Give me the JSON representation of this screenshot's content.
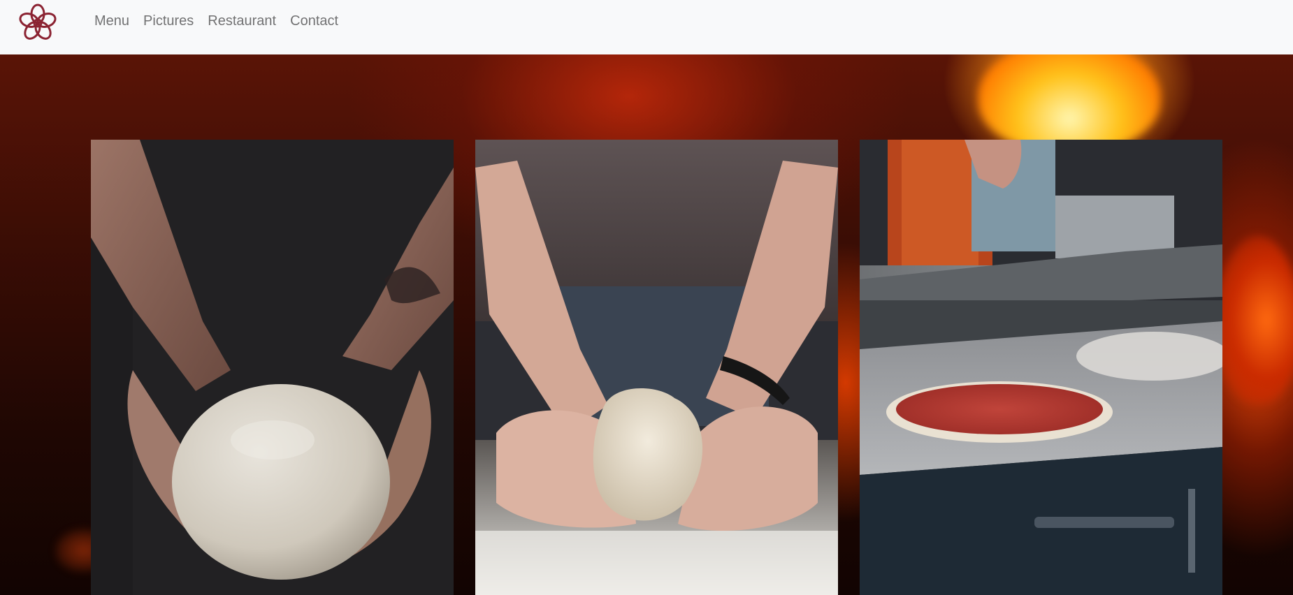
{
  "navbar": {
    "logo_icon": "flower-logo-icon",
    "links": [
      {
        "label": "Menu"
      },
      {
        "label": "Pictures"
      },
      {
        "label": "Restaurant"
      },
      {
        "label": "Contact"
      }
    ]
  },
  "gallery": {
    "photos": [
      {
        "subject": "hands-holding-dough-ball-image"
      },
      {
        "subject": "hands-kneading-dough-image"
      },
      {
        "subject": "pizza-base-on-counter-image"
      }
    ]
  },
  "colors": {
    "navbar_bg": "#f8f9fa",
    "logo": "#8b2332",
    "nav_text": "#737373",
    "hero_fire": "#b8330c"
  }
}
